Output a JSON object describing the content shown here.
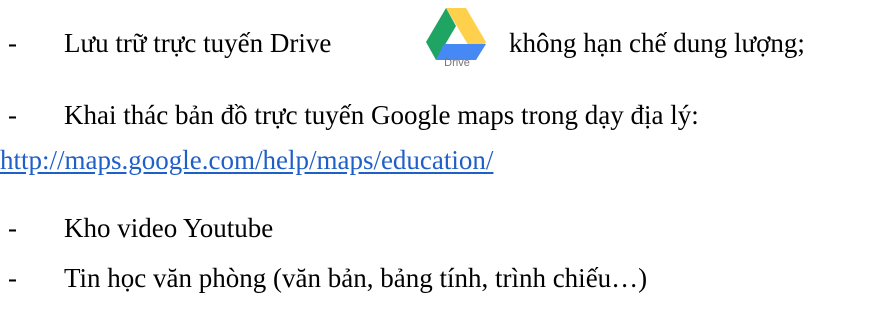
{
  "bullets": {
    "dash": "-",
    "item1_before": "Lưu trữ trực tuyến Drive",
    "item1_after": "không hạn chế dung lượng;",
    "item2": "Khai thác bản đồ trực tuyến Google maps trong dạy địa lý:",
    "item3": "Kho video Youtube",
    "item4": "Tin học văn phòng (văn bản, bảng tính, trình chiếu…)"
  },
  "link": {
    "url_text": "http://maps.google.com/help/maps/education/"
  },
  "drive_icon": {
    "name": "google-drive-icon",
    "label": "Drive",
    "colors": [
      "#1fa463",
      "#ffd04b",
      "#4688f4"
    ]
  }
}
